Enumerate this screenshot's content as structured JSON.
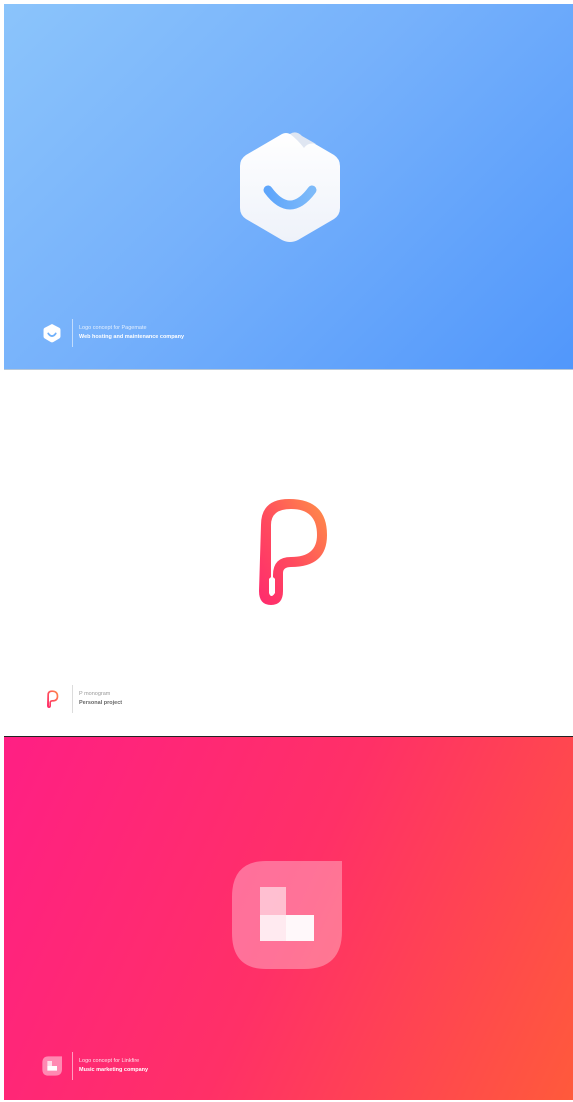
{
  "showcase": [
    {
      "logo_icon": "smiling-hexagon-page-icon",
      "caption_line1": "Logo concept for Pagemate",
      "caption_line2": "Web hosting and maintenance company",
      "background_colors": [
        "#8bc4fb",
        "#5197fb"
      ]
    },
    {
      "logo_icon": "p-monogram-icon",
      "caption_line1": "P monogram",
      "caption_line2": "Personal project",
      "background_colors": [
        "#ffffff"
      ],
      "logo_colors": [
        "#ff9147",
        "#ff2a6e"
      ]
    },
    {
      "logo_icon": "l-leaf-squares-icon",
      "caption_line1": "Logo concept for Linkfire",
      "caption_line2": "Music marketing company",
      "background_colors": [
        "#ff1f84",
        "#ff5a3b"
      ]
    }
  ]
}
